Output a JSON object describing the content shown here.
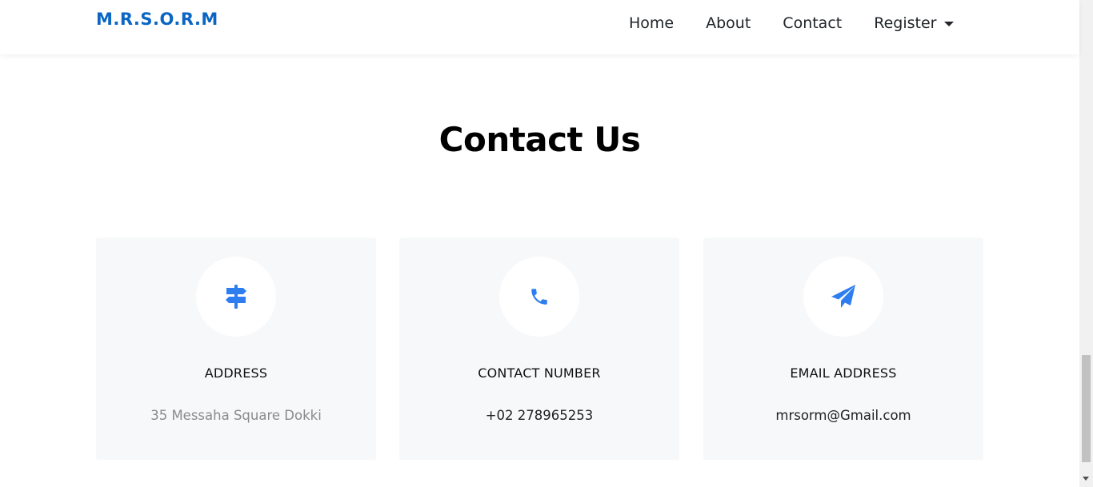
{
  "navbar": {
    "brand": "M.R.S.O.R.M",
    "links": [
      {
        "label": "Home"
      },
      {
        "label": "About"
      },
      {
        "label": "Contact"
      }
    ],
    "dropdown_label": "Register"
  },
  "section": {
    "title": "Contact Us"
  },
  "cards": [
    {
      "icon": "signpost-icon",
      "label": "ADDRESS",
      "value": "35 Messaha Square Dokki"
    },
    {
      "icon": "phone-icon",
      "label": "CONTACT NUMBER",
      "value": "+02 278965253"
    },
    {
      "icon": "paper-plane-icon",
      "label": "EMAIL ADDRESS",
      "value": "mrsorm@Gmail.com"
    }
  ],
  "colors": {
    "brand": "#0a66c2",
    "accent": "#2f7ef0",
    "card_bg": "#f7f8f9",
    "muted_text": "#8a8a8a"
  }
}
